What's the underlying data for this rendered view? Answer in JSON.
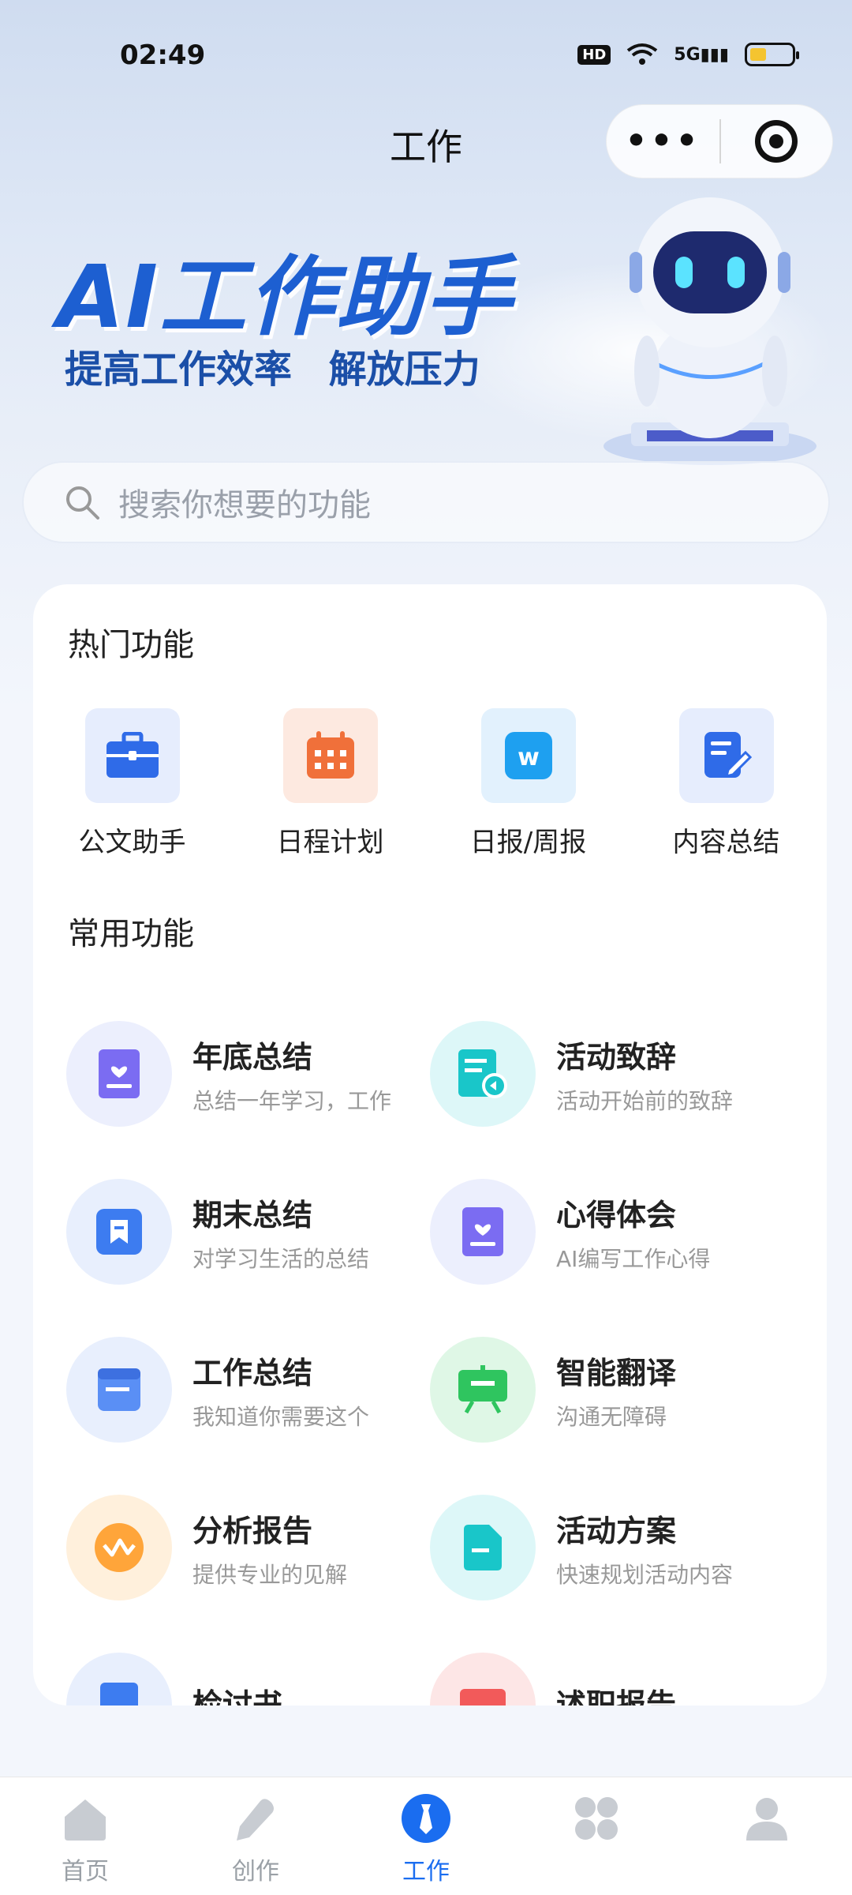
{
  "status": {
    "time": "02:49",
    "hd": "HD",
    "network": "5G"
  },
  "nav": {
    "title": "工作"
  },
  "hero": {
    "title": "AI工作助手",
    "subtitle": "提高工作效率 解放压力"
  },
  "search": {
    "placeholder": "搜索你想要的功能"
  },
  "hot": {
    "title": "热门功能",
    "items": [
      {
        "label": "公文助手",
        "icon": "briefcase-icon",
        "color": "#2f6be8"
      },
      {
        "label": "日程计划",
        "icon": "calendar-icon",
        "color": "#f0703a"
      },
      {
        "label": "日报/周报",
        "icon": "word-doc-icon",
        "color": "#1ea0f0"
      },
      {
        "label": "内容总结",
        "icon": "edit-note-icon",
        "color": "#2f6be8"
      }
    ]
  },
  "common": {
    "title": "常用功能",
    "items": [
      {
        "name": "年底总结",
        "desc": "总结一年学习，工作",
        "icon": "heart-doc-icon"
      },
      {
        "name": "活动致辞",
        "desc": "活动开始前的致辞",
        "icon": "speech-doc-icon"
      },
      {
        "name": "期末总结",
        "desc": "对学习生活的总结",
        "icon": "bookmark-icon"
      },
      {
        "name": "心得体会",
        "desc": "AI编写工作心得",
        "icon": "heart-doc-icon"
      },
      {
        "name": "工作总结",
        "desc": "我知道你需要这个",
        "icon": "document-icon"
      },
      {
        "name": "智能翻译",
        "desc": "沟通无障碍",
        "icon": "presentation-icon"
      },
      {
        "name": "分析报告",
        "desc": "提供专业的见解",
        "icon": "analytics-icon"
      },
      {
        "name": "活动方案",
        "desc": "快速规划活动内容",
        "icon": "file-icon"
      },
      {
        "name": "检讨书",
        "desc": "",
        "icon": "doc-icon"
      },
      {
        "name": "述职报告",
        "desc": "",
        "icon": "report-icon"
      }
    ]
  },
  "tabs": [
    {
      "label": "首页",
      "icon": "home-icon"
    },
    {
      "label": "创作",
      "icon": "pen-icon"
    },
    {
      "label": "工作",
      "icon": "tie-icon",
      "active": true
    },
    {
      "label": "",
      "icon": "apps-icon"
    },
    {
      "label": "",
      "icon": "profile-icon"
    }
  ],
  "colors": {
    "accent": "#1a6df0",
    "hero_title": "#1d5fd1",
    "hero_sub": "#1b4fa8"
  }
}
